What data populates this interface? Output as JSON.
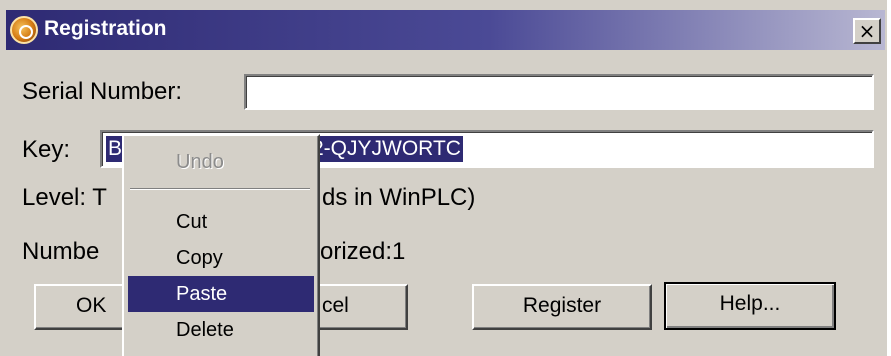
{
  "window": {
    "title": "Registration",
    "icon": "registration-app-icon",
    "close_glyph": "×"
  },
  "form": {
    "serial_number_label": "Serial Number:",
    "serial_number_value": "",
    "key_label": "Key:",
    "key_value_visible": "B-",
    "key_value_tail": "2-QJYJWORTC",
    "level_label_visible": "Level: T",
    "level_value_visible": "ds in WinPLC)",
    "number_label_visible": "Numbe",
    "number_value_visible": "orized:1"
  },
  "buttons": {
    "ok_visible": "OK",
    "cancel_visible": "cel",
    "register": "Register",
    "help": "Help..."
  },
  "context_menu": {
    "items": [
      {
        "label": "Undo",
        "state": "disabled"
      },
      {
        "label": "Cut",
        "state": "normal"
      },
      {
        "label": "Copy",
        "state": "normal"
      },
      {
        "label": "Paste",
        "state": "highlighted"
      },
      {
        "label": "Delete",
        "state": "normal"
      }
    ]
  },
  "colors": {
    "titlebar": "#2e2a73",
    "selection": "#2e2a73",
    "dialog_bg": "#d4d0c8"
  }
}
